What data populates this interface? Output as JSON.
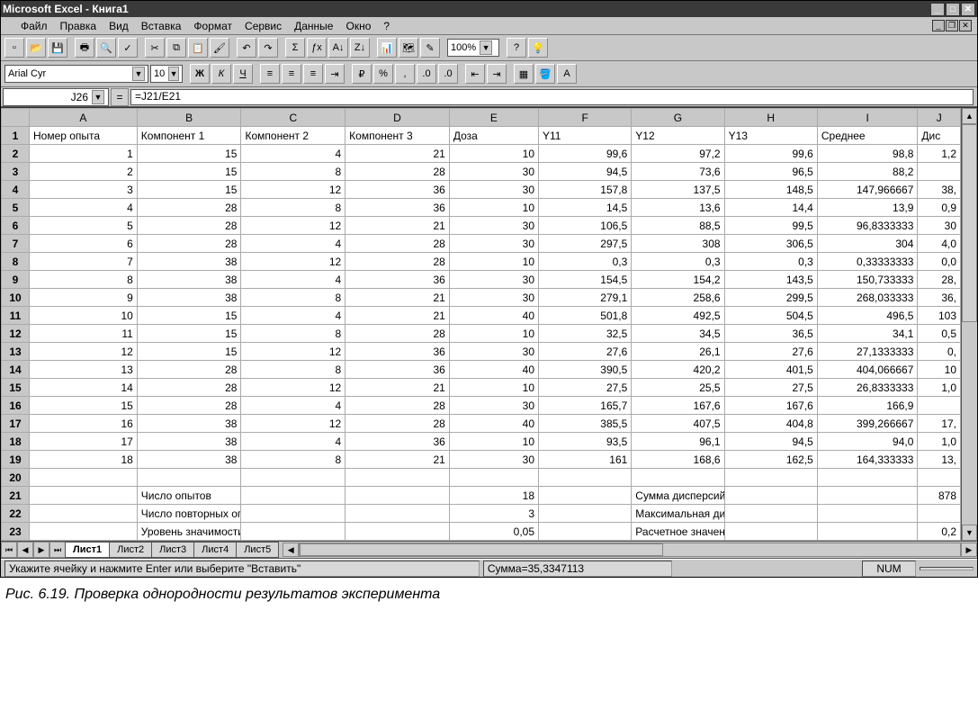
{
  "window": {
    "title": "Microsoft Excel - Книга1"
  },
  "menu": {
    "items": [
      "Файл",
      "Правка",
      "Вид",
      "Вставка",
      "Формат",
      "Сервис",
      "Данные",
      "Окно",
      "?"
    ]
  },
  "toolbar": {
    "font": "Arial Cyr",
    "fontsize": "10",
    "zoom": "100%"
  },
  "formula": {
    "cellname": "J26",
    "value": "=J21/E21"
  },
  "columns": [
    "A",
    "B",
    "C",
    "D",
    "E",
    "F",
    "G",
    "H",
    "I",
    "J"
  ],
  "header_row": [
    "Номер опыта",
    "Компонент 1",
    "Компонент 2",
    "Компонент 3",
    "Доза",
    "Y11",
    "Y12",
    "Y13",
    "Среднее",
    "Дис"
  ],
  "data_rows": [
    [
      "1",
      "15",
      "4",
      "21",
      "10",
      "99,6",
      "97,2",
      "99,6",
      "98,8",
      "1,2"
    ],
    [
      "2",
      "15",
      "8",
      "28",
      "30",
      "94,5",
      "73,6",
      "96,5",
      "88,2",
      ""
    ],
    [
      "3",
      "15",
      "12",
      "36",
      "30",
      "157,8",
      "137,5",
      "148,5",
      "147,966667",
      "38,"
    ],
    [
      "4",
      "28",
      "8",
      "36",
      "10",
      "14,5",
      "13,6",
      "14,4",
      "13,9",
      "0,9"
    ],
    [
      "5",
      "28",
      "12",
      "21",
      "30",
      "106,5",
      "88,5",
      "99,5",
      "96,8333333",
      "30"
    ],
    [
      "6",
      "28",
      "4",
      "28",
      "30",
      "297,5",
      "308",
      "306,5",
      "304",
      "4,0"
    ],
    [
      "7",
      "38",
      "12",
      "28",
      "10",
      "0,3",
      "0,3",
      "0,3",
      "0,33333333",
      "0,0"
    ],
    [
      "8",
      "38",
      "4",
      "36",
      "30",
      "154,5",
      "154,2",
      "143,5",
      "150,733333",
      "28,"
    ],
    [
      "9",
      "38",
      "8",
      "21",
      "30",
      "279,1",
      "258,6",
      "299,5",
      "268,033333",
      "36,"
    ],
    [
      "10",
      "15",
      "4",
      "21",
      "40",
      "501,8",
      "492,5",
      "504,5",
      "496,5",
      "103"
    ],
    [
      "11",
      "15",
      "8",
      "28",
      "10",
      "32,5",
      "34,5",
      "36,5",
      "34,1",
      "0,5"
    ],
    [
      "12",
      "15",
      "12",
      "36",
      "30",
      "27,6",
      "26,1",
      "27,6",
      "27,1333333",
      "0,"
    ],
    [
      "13",
      "28",
      "8",
      "36",
      "40",
      "390,5",
      "420,2",
      "401,5",
      "404,066667",
      "10"
    ],
    [
      "14",
      "28",
      "12",
      "21",
      "10",
      "27,5",
      "25,5",
      "27,5",
      "26,8333333",
      "1,0"
    ],
    [
      "15",
      "28",
      "4",
      "28",
      "30",
      "165,7",
      "167,6",
      "167,6",
      "166,9",
      ""
    ],
    [
      "16",
      "38",
      "12",
      "28",
      "40",
      "385,5",
      "407,5",
      "404,8",
      "399,266667",
      "17,"
    ],
    [
      "17",
      "38",
      "4",
      "36",
      "10",
      "93,5",
      "96,1",
      "94,5",
      "94,0",
      "1,0"
    ],
    [
      "18",
      "38",
      "8",
      "21",
      "30",
      "161",
      "168,6",
      "162,5",
      "164,333333",
      "13,"
    ]
  ],
  "summary": {
    "items": [
      {
        "labelB": "Число опытов",
        "valE": "18",
        "labelG": "Сумма дисперсий",
        "valJ": "878"
      },
      {
        "labelB": "Число повторных опытов",
        "valE": "3",
        "labelG": "Максимальная дисперсия",
        "valJ": ""
      },
      {
        "labelB": "Уровень значимости",
        "valE": "0,05",
        "labelG": "Расчетное значение G-критерия",
        "valJ": "0,2"
      }
    ]
  },
  "tabs": {
    "items": [
      "Лист1",
      "Лист2",
      "Лист3",
      "Лист4",
      "Лист5"
    ],
    "active": 0
  },
  "status": {
    "message": "Укажите ячейку и нажмите Enter или выберите \"Вставить\"",
    "sum": "Сумма=35,3347113",
    "num": "NUM"
  },
  "caption": "Рис. 6.19. Проверка однородности результатов эксперимента"
}
